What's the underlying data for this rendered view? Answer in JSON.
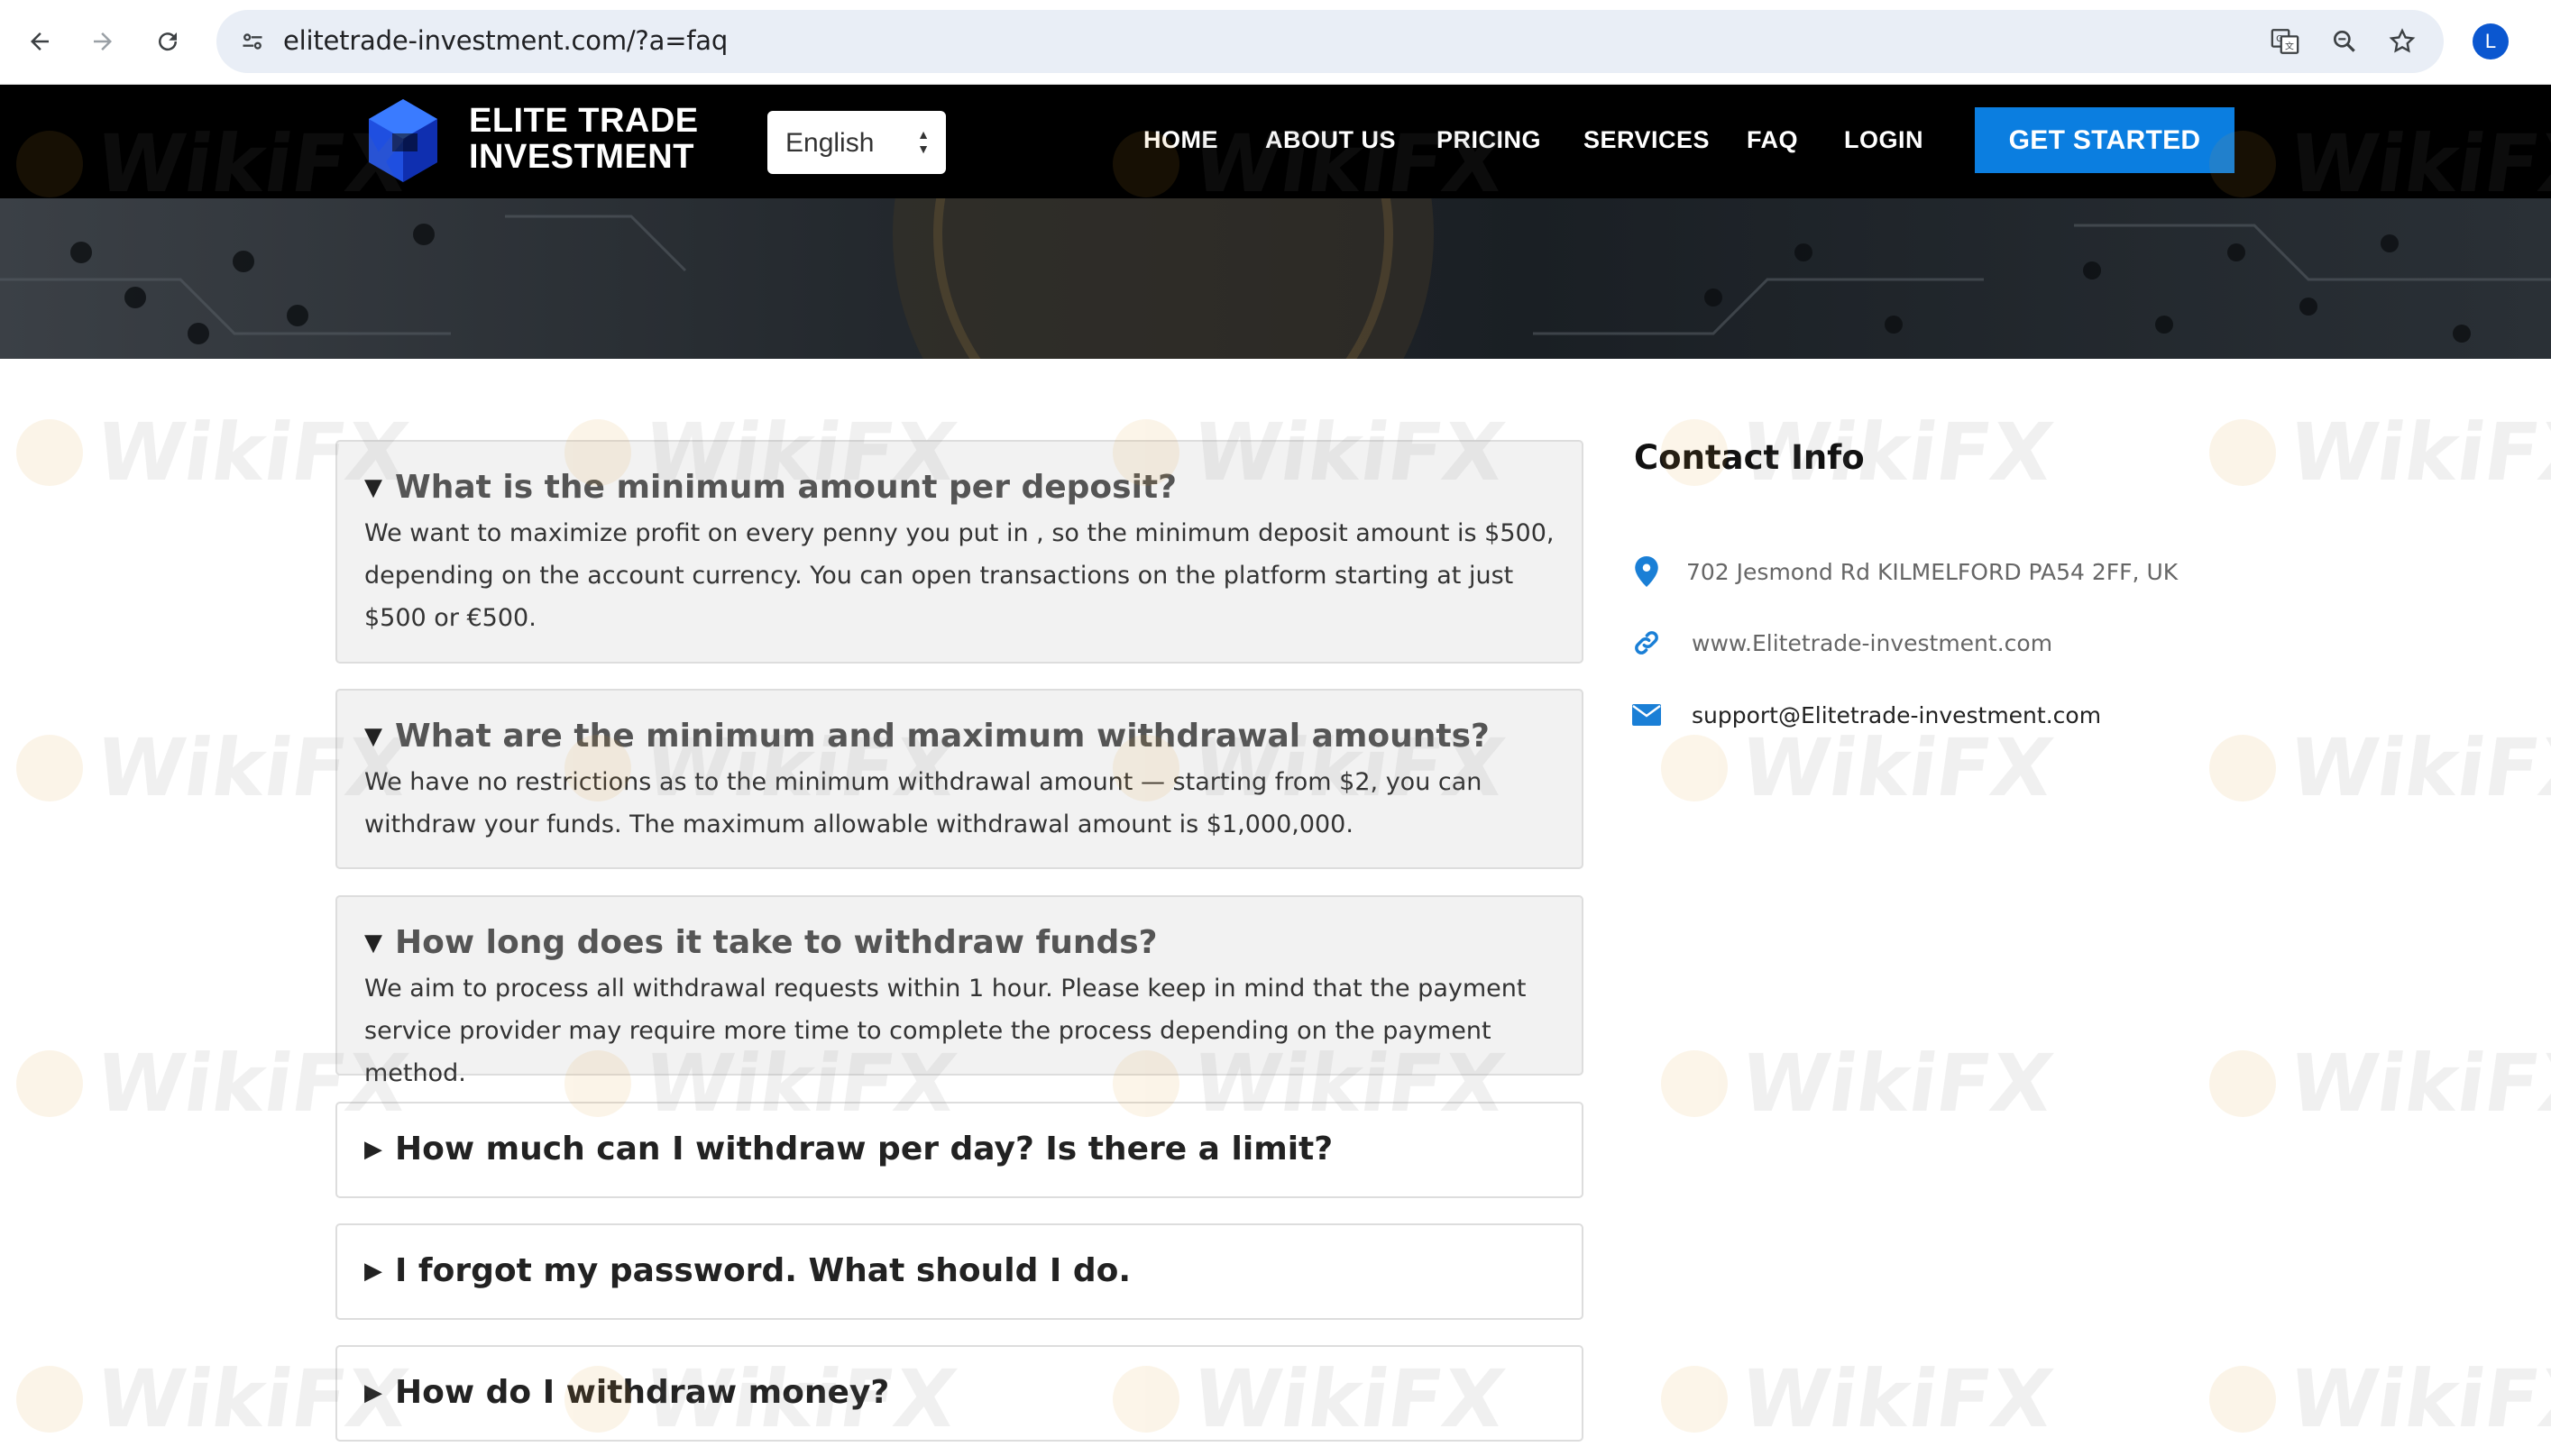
{
  "browser": {
    "url": "elitetrade-investment.com/?a=faq",
    "profile_initial": "L"
  },
  "site": {
    "logo_line1": "ELITE TRADE",
    "logo_line2": "INVESTMENT",
    "language": "English",
    "menu": [
      "HOME",
      "ABOUT US",
      "PRICING",
      "SERVICES",
      "FAQ",
      "LOGIN"
    ],
    "cta": "GET STARTED"
  },
  "faqs": [
    {
      "question": "What is the minimum amount per deposit?",
      "answer": "We want to maximize profit on every penny you put in , so the minimum deposit amount is $500, depending on the account currency. You can open transactions on the platform starting at just $500 or €500.",
      "open": true
    },
    {
      "question": "What are the minimum and maximum withdrawal amounts?",
      "answer": "We have no restrictions as to the minimum withdrawal amount — starting from $2, you can withdraw your funds. The maximum allowable withdrawal amount is $1,000,000.",
      "open": true
    },
    {
      "question": "How long does it take to withdraw funds?",
      "answer": "We aim to process all withdrawal requests within 1 hour. Please keep in mind that the payment service provider may require more time to complete the process depending on the payment method.",
      "open": true
    },
    {
      "question": "How much can I withdraw per day? Is there a limit?",
      "open": false
    },
    {
      "question": "I forgot my password. What should I do.",
      "open": false
    },
    {
      "question": "How do I withdraw money?",
      "open": false
    }
  ],
  "contact": {
    "title": "Contact Info",
    "address": "702 Jesmond Rd KILMELFORD PA54 2FF, UK",
    "website": "www.Elitetrade-investment.com",
    "email": "support@Elitetrade-investment.com"
  },
  "watermark": "WikiFX",
  "colors": {
    "accent": "#0b7ee0",
    "header_bg": "#000000",
    "icon_blue": "#1a7fd6"
  }
}
